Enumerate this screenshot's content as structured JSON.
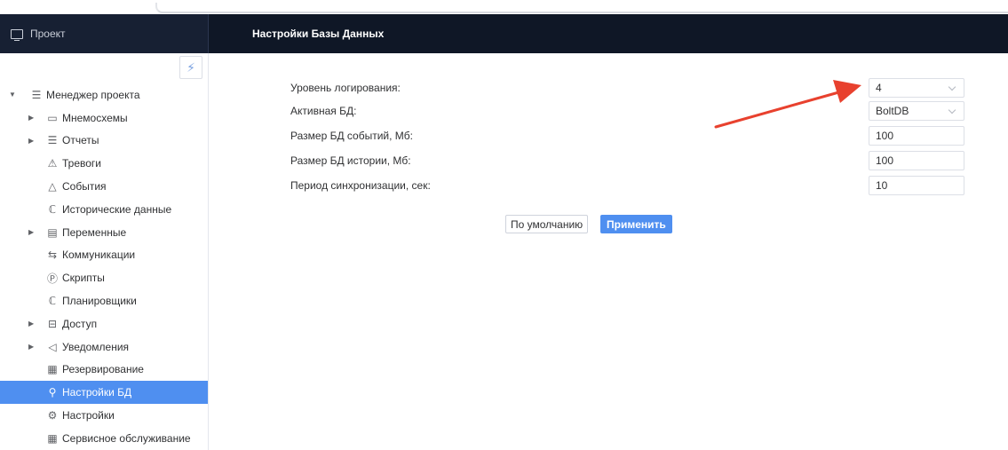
{
  "sidebar": {
    "header_title": "Проект",
    "items": [
      {
        "label": "Менеджер проекта",
        "icon": "document-list-icon",
        "glyph": "☰",
        "caret": "▼"
      },
      {
        "label": "Мнемосхемы",
        "icon": "mnemo-icon",
        "glyph": "▭",
        "caret": "▶"
      },
      {
        "label": "Отчеты",
        "icon": "report-icon",
        "glyph": "☰",
        "caret": "▶"
      },
      {
        "label": "Тревоги",
        "icon": "alarm-icon",
        "glyph": "⚠",
        "caret": ""
      },
      {
        "label": "События",
        "icon": "warning-triangle-icon",
        "glyph": "△",
        "caret": ""
      },
      {
        "label": "Исторические данные",
        "icon": "history-icon",
        "glyph": "ℂ",
        "caret": ""
      },
      {
        "label": "Переменные",
        "icon": "variables-icon",
        "glyph": "▤",
        "caret": "▶"
      },
      {
        "label": "Коммуникации",
        "icon": "connection-icon",
        "glyph": "⇆",
        "caret": ""
      },
      {
        "label": "Скрипты",
        "icon": "script-icon",
        "glyph": "Ⓟ",
        "caret": ""
      },
      {
        "label": "Планировщики",
        "icon": "scheduler-icon",
        "glyph": "ℂ",
        "caret": ""
      },
      {
        "label": "Доступ",
        "icon": "lock-icon",
        "glyph": "⊟",
        "caret": "▶"
      },
      {
        "label": "Уведомления",
        "icon": "megaphone-icon",
        "glyph": "◁",
        "caret": "▶"
      },
      {
        "label": "Резервирование",
        "icon": "backup-icon",
        "glyph": "▦",
        "caret": ""
      },
      {
        "label": "Настройки БД",
        "icon": "wrench-icon",
        "glyph": "⚲",
        "caret": ""
      },
      {
        "label": "Настройки",
        "icon": "gear-icon",
        "glyph": "⚙",
        "caret": ""
      },
      {
        "label": "Сервисное обслуживание",
        "icon": "service-icon",
        "glyph": "▦",
        "caret": ""
      }
    ],
    "active_index": 13,
    "lightning_glyph": "⚡"
  },
  "main": {
    "title": "Настройки Базы Данных",
    "fields": [
      {
        "label": "Уровень логирования",
        "value": "4",
        "type": "select"
      },
      {
        "label": "Активная БД",
        "value": "BoltDB",
        "type": "select"
      },
      {
        "label": "Размер БД событий, Мб",
        "value": "100",
        "type": "input"
      },
      {
        "label": "Размер БД истории, Мб",
        "value": "100",
        "type": "input"
      },
      {
        "label": "Период синхронизации, сек",
        "value": "10",
        "type": "input"
      }
    ],
    "label_suffix": ":",
    "buttons": {
      "default_label": "По умолчанию",
      "apply_label": "Применить"
    }
  },
  "colors": {
    "accent": "#4f8ff0",
    "header_bg": "#0f1726",
    "sidebar_header_bg": "#172033",
    "arrow": "#e8412e"
  }
}
